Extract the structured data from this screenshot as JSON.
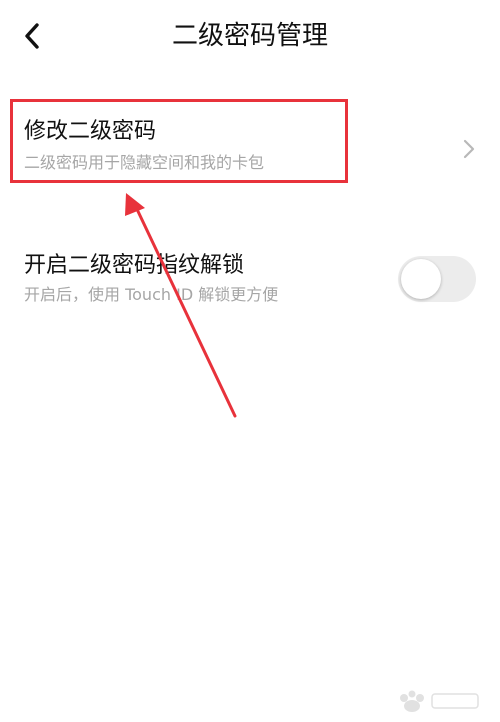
{
  "header": {
    "title": "二级密码管理",
    "back_icon": "chevron-left-icon"
  },
  "settings": {
    "items": [
      {
        "title": "修改二级密码",
        "subtitle": "二级密码用于隐藏空间和我的卡包",
        "trailing": "chevron-right-icon"
      },
      {
        "title": "开启二级密码指纹解锁",
        "subtitle": "开启后，使用 Touch ID 解锁更方便",
        "trailing": "toggle",
        "toggle_on": false
      }
    ]
  },
  "annotation": {
    "highlight_color": "#e8323b",
    "arrow_color": "#e8323b"
  },
  "colors": {
    "title_text": "#111111",
    "subtitle_text": "#a6a6a6",
    "toggle_off": "#ececec"
  }
}
